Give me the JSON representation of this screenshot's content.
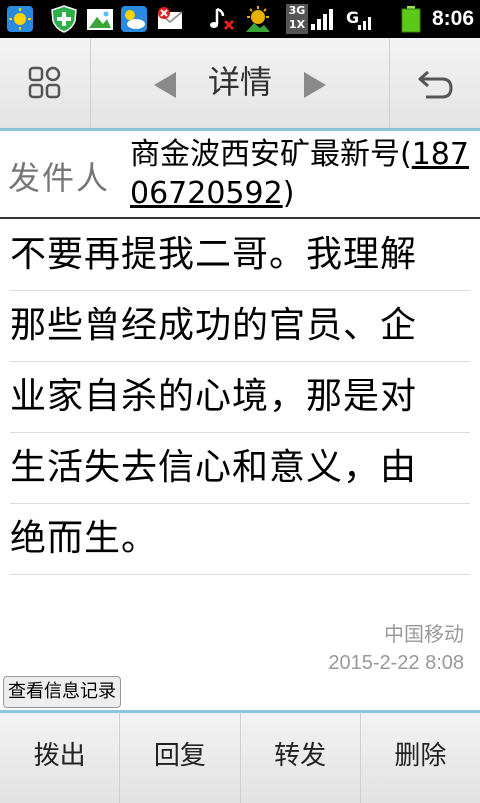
{
  "status_bar": {
    "time": "8:06",
    "network_badge_top": "3G",
    "network_badge_bottom": "1X",
    "icons": [
      "weather-sun-icon",
      "shield-plus-icon",
      "gallery-icon",
      "weather-cloud-icon",
      "mail-error-icon",
      "music-muted-icon",
      "sun-bright-icon",
      "signal-3g-1x-icon",
      "gprs-signal-icon",
      "battery-icon"
    ]
  },
  "toolbar": {
    "title": "详情",
    "left_icon": "apps-grid-icon",
    "right_icon": "back-arrow-icon"
  },
  "sender": {
    "label": "发件人",
    "name": "商金波西安矿最新号(",
    "number": "18706720592",
    "closing": ")"
  },
  "message": {
    "lines": [
      "不要再提我二哥。我理解",
      "那些曾经成功的官员、企",
      "业家自杀的心境，那是对",
      "生活失去信心和意义，由",
      "绝而生。"
    ]
  },
  "meta": {
    "carrier": "中国移动",
    "datetime": "2015-2-22 8:08"
  },
  "history_button": "查看信息记录",
  "actions": {
    "call": "拨出",
    "reply": "回复",
    "forward": "转发",
    "delete": "删除"
  },
  "colors": {
    "accent": "#8cc4dc",
    "label_gray": "#777777",
    "meta_gray": "#999999"
  }
}
